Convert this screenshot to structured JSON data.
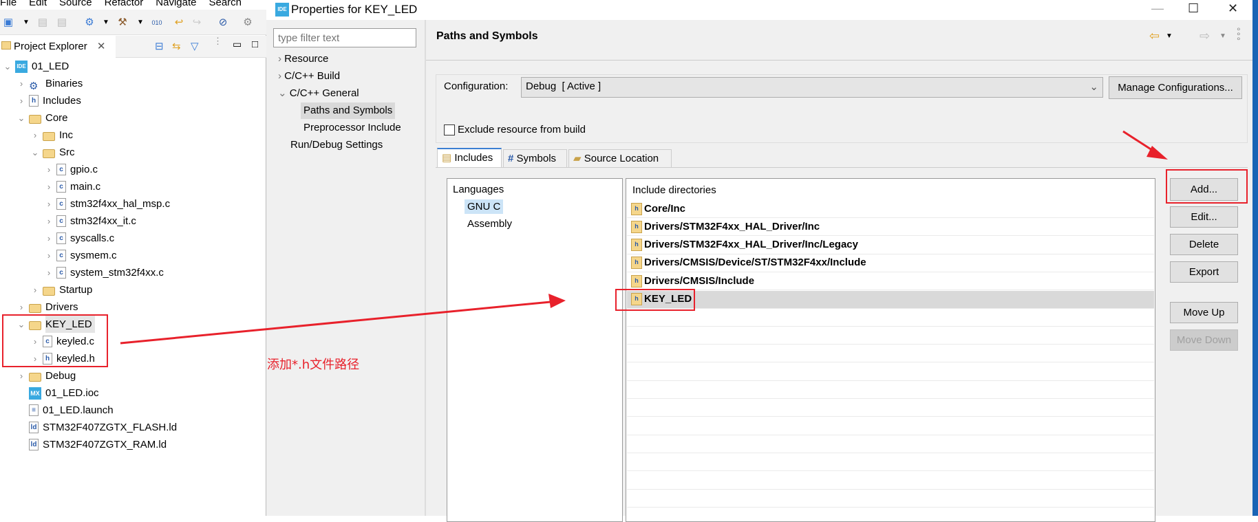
{
  "ide": {
    "menu": [
      "File",
      "Edit",
      "Source",
      "Refactor",
      "Navigate",
      "Search"
    ],
    "project_explorer": {
      "title": "Project Explorer",
      "tree": [
        {
          "label": "01_LED",
          "level": 0,
          "expanded": true,
          "icon": "ide-project-icon"
        },
        {
          "label": "Binaries",
          "level": 1,
          "expanded": false,
          "icon": "binaries-icon"
        },
        {
          "label": "Includes",
          "level": 1,
          "expanded": false,
          "icon": "includes-icon"
        },
        {
          "label": "Core",
          "level": 1,
          "expanded": true,
          "icon": "source-folder-icon"
        },
        {
          "label": "Inc",
          "level": 2,
          "expanded": false,
          "icon": "folder-icon"
        },
        {
          "label": "Src",
          "level": 2,
          "expanded": true,
          "icon": "folder-icon"
        },
        {
          "label": "gpio.c",
          "level": 3,
          "expanded": false,
          "icon": "c-file-icon"
        },
        {
          "label": "main.c",
          "level": 3,
          "expanded": false,
          "icon": "c-file-icon"
        },
        {
          "label": "stm32f4xx_hal_msp.c",
          "level": 3,
          "expanded": false,
          "icon": "c-file-icon"
        },
        {
          "label": "stm32f4xx_it.c",
          "level": 3,
          "expanded": false,
          "icon": "c-file-icon"
        },
        {
          "label": "syscalls.c",
          "level": 3,
          "expanded": false,
          "icon": "c-file-icon"
        },
        {
          "label": "sysmem.c",
          "level": 3,
          "expanded": false,
          "icon": "c-file-icon"
        },
        {
          "label": "system_stm32f4xx.c",
          "level": 3,
          "expanded": false,
          "icon": "c-file-icon"
        },
        {
          "label": "Startup",
          "level": 2,
          "expanded": false,
          "icon": "folder-icon"
        },
        {
          "label": "Drivers",
          "level": 1,
          "expanded": false,
          "icon": "source-folder-icon"
        },
        {
          "label": "KEY_LED",
          "level": 1,
          "expanded": true,
          "icon": "source-folder-icon",
          "selected": true
        },
        {
          "label": "keyled.c",
          "level": 2,
          "expanded": false,
          "icon": "c-file-icon"
        },
        {
          "label": "keyled.h",
          "level": 2,
          "expanded": false,
          "icon": "h-file-icon"
        },
        {
          "label": "Debug",
          "level": 1,
          "expanded": false,
          "icon": "folder-icon"
        },
        {
          "label": "01_LED.ioc",
          "level": 1,
          "icon": "mx-file-icon"
        },
        {
          "label": "01_LED.launch",
          "level": 1,
          "icon": "text-file-icon"
        },
        {
          "label": "STM32F407ZGTX_FLASH.ld",
          "level": 1,
          "icon": "ld-file-icon"
        },
        {
          "label": "STM32F407ZGTX_RAM.ld",
          "level": 1,
          "icon": "ld-file-icon"
        }
      ]
    }
  },
  "dialog": {
    "title": "Properties for KEY_LED",
    "icon_text": "IDE",
    "filter_placeholder": "type filter text",
    "nav": [
      {
        "label": "Resource",
        "chevron": ">",
        "level": 0
      },
      {
        "label": "C/C++ Build",
        "chevron": ">",
        "level": 0
      },
      {
        "label": "C/C++ General",
        "chevron": "v",
        "level": 0
      },
      {
        "label": "Paths and Symbols",
        "level": 1,
        "selected": true
      },
      {
        "label": "Preprocessor Include",
        "level": 1
      },
      {
        "label": "Run/Debug Settings",
        "level": 0
      }
    ],
    "page_title": "Paths and Symbols",
    "configuration_label": "Configuration:",
    "configuration_value": "Debug  [ Active ]",
    "manage_button": "Manage Configurations...",
    "exclude_label": "Exclude resource from build",
    "exclude_checked": false,
    "tabs": [
      {
        "label": "Includes",
        "icon": "includes-icon",
        "active": true
      },
      {
        "label": "Symbols",
        "icon": "hash-icon"
      },
      {
        "label": "Source Location",
        "icon": "source-folder-icon"
      }
    ],
    "languages_header": "Languages",
    "languages": [
      {
        "label": "GNU C",
        "selected": true
      },
      {
        "label": "Assembly"
      }
    ],
    "include_header": "Include directories",
    "include_dirs": [
      "Core/Inc",
      "Drivers/STM32F4xx_HAL_Driver/Inc",
      "Drivers/STM32F4xx_HAL_Driver/Inc/Legacy",
      "Drivers/CMSIS/Device/ST/STM32F4xx/Include",
      "Drivers/CMSIS/Include",
      "KEY_LED"
    ],
    "selected_include": "KEY_LED",
    "buttons": {
      "add": "Add...",
      "edit": "Edit...",
      "delete": "Delete",
      "export": "Export",
      "move_up": "Move Up",
      "move_down": "Move Down"
    }
  },
  "annotation": {
    "text": "添加*.h文件路径",
    "color": "#e8212b"
  }
}
